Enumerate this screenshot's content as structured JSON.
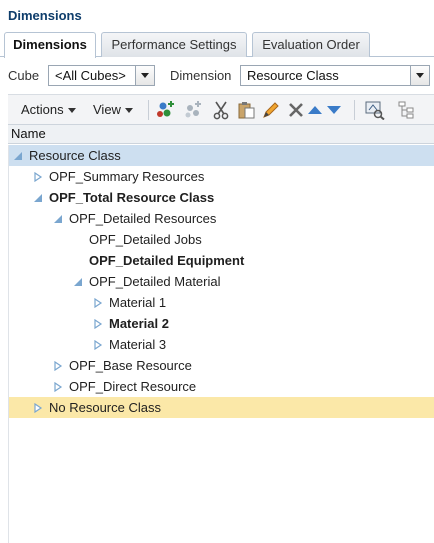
{
  "page_title": "Dimensions",
  "tabs": [
    {
      "label": "Dimensions",
      "active": true
    },
    {
      "label": "Performance Settings",
      "active": false
    },
    {
      "label": "Evaluation Order",
      "active": false
    }
  ],
  "filters": {
    "cube_label": "Cube",
    "cube_value": "<All Cubes>",
    "dimension_label": "Dimension",
    "dimension_value": "Resource Class"
  },
  "toolbar": {
    "actions_label": "Actions",
    "view_label": "View",
    "icons": [
      "add-child-icon",
      "add-sibling-icon",
      "cut-icon",
      "paste-icon",
      "edit-icon",
      "delete-icon",
      "move-up-icon",
      "move-down-icon",
      "member-formula-icon",
      "hierarchy-icon"
    ]
  },
  "tree": {
    "column_header": "Name",
    "rows": [
      {
        "label": "Resource Class",
        "state": "expanded",
        "selected": true
      },
      {
        "label": "OPF_Summary Resources",
        "state": "collapsed"
      },
      {
        "label": "OPF_Total Resource Class",
        "state": "expanded"
      },
      {
        "label": "OPF_Detailed Resources",
        "state": "expanded"
      },
      {
        "label": "OPF_Detailed Jobs",
        "state": "leaf"
      },
      {
        "label": "OPF_Detailed Equipment",
        "state": "leaf"
      },
      {
        "label": "OPF_Detailed Material",
        "state": "expanded"
      },
      {
        "label": "Material 1",
        "state": "collapsed"
      },
      {
        "label": "Material 2",
        "state": "collapsed"
      },
      {
        "label": "Material 3",
        "state": "collapsed"
      },
      {
        "label": "OPF_Base Resource",
        "state": "collapsed"
      },
      {
        "label": "OPF_Direct Resource",
        "state": "collapsed"
      },
      {
        "label": "No Resource Class",
        "state": "collapsed",
        "highlighted": true
      }
    ]
  },
  "colors": {
    "title": "#0e3d6b",
    "selected_row": "#cddff0",
    "highlighted_row": "#fbe8a8",
    "twisty": "#7aa6cf"
  }
}
